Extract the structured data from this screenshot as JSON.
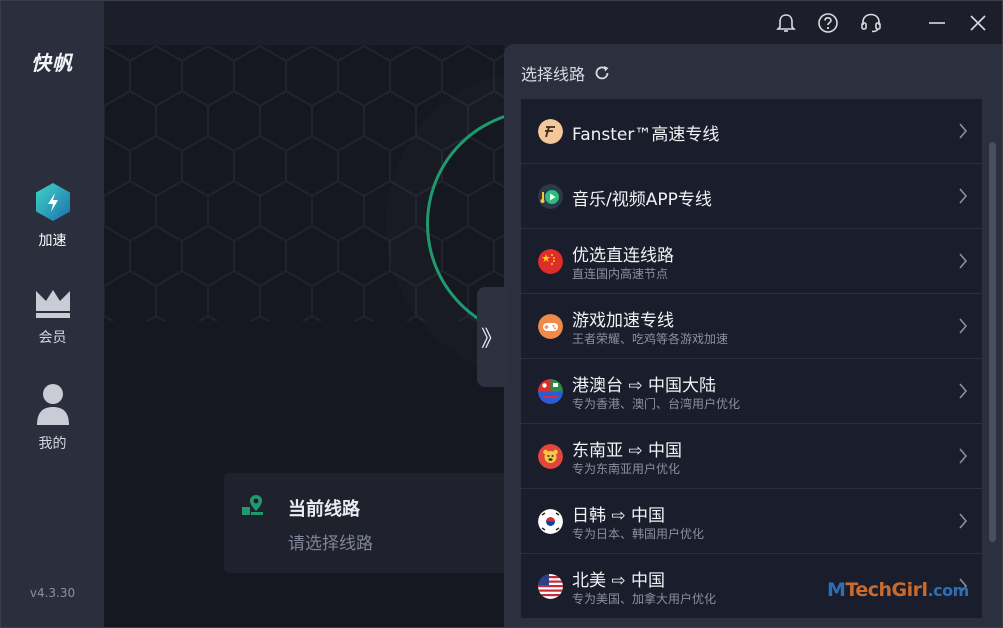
{
  "app": {
    "logo": "快帆",
    "version": "v4.3.30"
  },
  "sidebar": {
    "items": [
      {
        "label": "加速",
        "icon": "lightning-hexagon-icon"
      },
      {
        "label": "会员",
        "icon": "crown-icon"
      },
      {
        "label": "我的",
        "icon": "user-icon"
      }
    ]
  },
  "titlebar": {
    "icons": [
      "bell-icon",
      "help-icon",
      "support-headset-icon",
      "minimize-icon",
      "close-icon"
    ]
  },
  "main": {
    "current_route_title": "当前线路",
    "current_route_placeholder": "请选择线路",
    "expand_label": "》"
  },
  "panel": {
    "title": "选择线路",
    "routes": [
      {
        "title": "Fanster™高速专线",
        "sub": "",
        "icon": "fanster-logo-icon"
      },
      {
        "title": "音乐/视频APP专线",
        "sub": "",
        "icon": "music-video-icon"
      },
      {
        "title": "优选直连线路",
        "sub": "直连国内高速节点",
        "icon": "china-flag-icon"
      },
      {
        "title": "游戏加速专线",
        "sub": "王者荣耀、吃鸡等各游戏加速",
        "icon": "gamepad-icon"
      },
      {
        "title": "港澳台 ⇨ 中国大陆",
        "sub": "专为香港、澳门、台湾用户优化",
        "icon": "hk-macau-taiwan-flag-icon"
      },
      {
        "title": "东南亚 ⇨ 中国",
        "sub": "专为东南亚用户优化",
        "icon": "southeast-asia-icon"
      },
      {
        "title": "日韩 ⇨ 中国",
        "sub": "专为日本、韩国用户优化",
        "icon": "japan-korea-flag-icon"
      },
      {
        "title": "北美 ⇨ 中国",
        "sub": "专为美国、加拿大用户优化",
        "icon": "usa-flag-icon"
      }
    ]
  },
  "watermark": {
    "part1": "M",
    "part2": "TechGirl",
    "part3": ".com"
  },
  "colors": {
    "accent_green": "#1f9a6f",
    "panel_bg": "#2b2f3e",
    "row_bg": "#1a1d2b",
    "sidebar_bg": "#2a2e3d"
  }
}
